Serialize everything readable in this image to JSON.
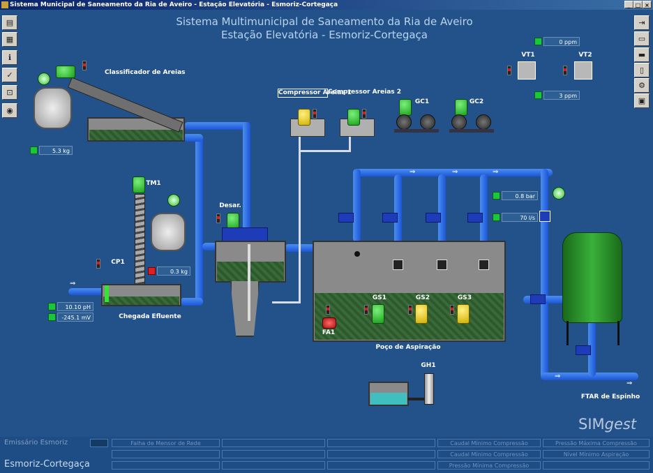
{
  "window": {
    "title": "Sistema Municipal de Saneamento da Ria de Aveiro - Estação Elevatória - Esmoriz-Cortegaça",
    "controls": [
      "_",
      "□",
      "×"
    ]
  },
  "header": {
    "line1": "Sistema Multimunicipal de Saneamento da Ria de Aveiro",
    "line2": "Estação Elevatória - Esmoriz-Cortegaça"
  },
  "left_toolbar": [
    "▤",
    "▦",
    "ℹ",
    "✓",
    "⊡",
    "◉"
  ],
  "right_toolbar": [
    "⇥",
    "▭",
    "▬",
    "▯",
    "⚙",
    "▣"
  ],
  "labels": {
    "classificador": "Classificador de Areias",
    "compressor1": "Compressor Areias 1",
    "compressor2": "Compressor Areias 2",
    "gc1": "GC1",
    "gc2": "GC2",
    "vt1": "VT1",
    "vt2": "VT2",
    "tm1": "TM1",
    "desar": "Desar.",
    "cp1": "CP1",
    "chegada": "Chegada Efluente",
    "gs1": "GS1",
    "gs2": "GS2",
    "gs3": "GS3",
    "fa1": "FA1",
    "poco": "Poço de Aspiração",
    "gh1": "GH1",
    "ftar": "FTAR de Espinho",
    "brand_sim": "SIM",
    "brand_gest": "gest"
  },
  "readings": {
    "classificador_weight": "5.3 kg",
    "tm_weight": "0.3 kg",
    "ph": "10.10 pH",
    "redox": "-245.1 mV",
    "ppm_top": "0 ppm",
    "ppm_bottom": "3 ppm",
    "pressure": "0.8 bar",
    "flow": "70 l/s"
  },
  "status_bar": {
    "site_label": "Emissário Esmoriz",
    "site_name": "Esmoriz-Cortegaça",
    "alarm_falta": "Falha de Mensor de Rede",
    "alarm_caudal1": "Caudal Mínimo Compressão",
    "alarm_caudal2": "Caudal Mínimo Compressão",
    "alarm_pressao_min": "Pressão Mínima Compressão",
    "alarm_pressao_max": "Pressão Máxima Compressão",
    "alarm_nivel": "Nível Mínimo Aspiração"
  },
  "colors": {
    "background": "#23528a",
    "pipe": "#2a6ee8",
    "tank_green": "#1f7a1f",
    "led_ok": "#18c838",
    "led_alarm": "#e02020"
  }
}
